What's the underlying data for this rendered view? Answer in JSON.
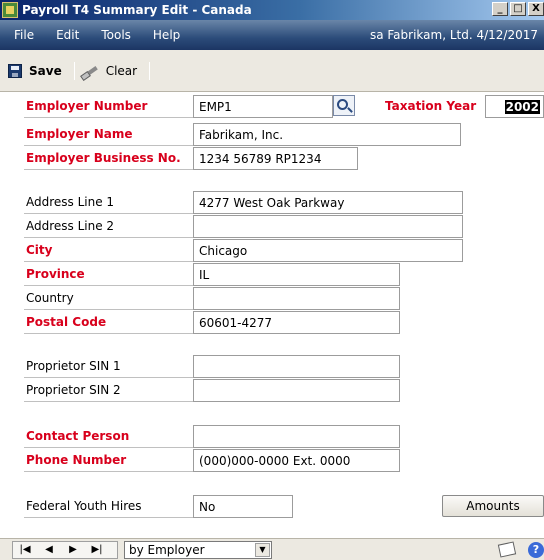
{
  "window": {
    "title": "Payroll T4 Summary Edit - Canada",
    "min": "_",
    "max": "□",
    "close": "X"
  },
  "menu": {
    "items": [
      "File",
      "Edit",
      "Tools",
      "Help"
    ],
    "user_info": "sa  Fabrikam, Ltd.  4/12/2017"
  },
  "toolbar": {
    "save_label": "Save",
    "clear_label": "Clear"
  },
  "fields": {
    "employer_number": {
      "label": "Employer Number",
      "value": "EMP1"
    },
    "taxation_year": {
      "label": "Taxation Year",
      "value": "2002"
    },
    "employer_name": {
      "label": "Employer Name",
      "value": "Fabrikam, Inc."
    },
    "employer_business_no": {
      "label": "Employer Business No.",
      "value": "1234 56789 RP1234"
    },
    "address_line_1": {
      "label": "Address Line 1",
      "value": "4277 West Oak Parkway"
    },
    "address_line_2": {
      "label": "Address Line 2",
      "value": ""
    },
    "city": {
      "label": "City",
      "value": "Chicago"
    },
    "province": {
      "label": "Province",
      "value": "IL"
    },
    "country": {
      "label": "Country",
      "value": ""
    },
    "postal_code": {
      "label": "Postal Code",
      "value": "60601-4277"
    },
    "proprietor_sin_1": {
      "label": "Proprietor SIN 1",
      "value": ""
    },
    "proprietor_sin_2": {
      "label": "Proprietor SIN 2",
      "value": ""
    },
    "contact_person": {
      "label": "Contact Person",
      "value": ""
    },
    "phone_number": {
      "label": "Phone Number",
      "value": "(000)000-0000 Ext. 0000"
    },
    "federal_youth_hires": {
      "label": "Federal Youth Hires",
      "value": "No"
    }
  },
  "buttons": {
    "amounts": "Amounts"
  },
  "statusbar": {
    "nav": [
      "|◀",
      "◀",
      "▶",
      "▶|"
    ],
    "sort_by": "by Employer",
    "dropdown_arrow": "▼",
    "help_glyph": "?"
  },
  "colors": {
    "required_label": "#d8001c",
    "menubar": "#2c4c7a",
    "titlebar": "#0a246a"
  }
}
